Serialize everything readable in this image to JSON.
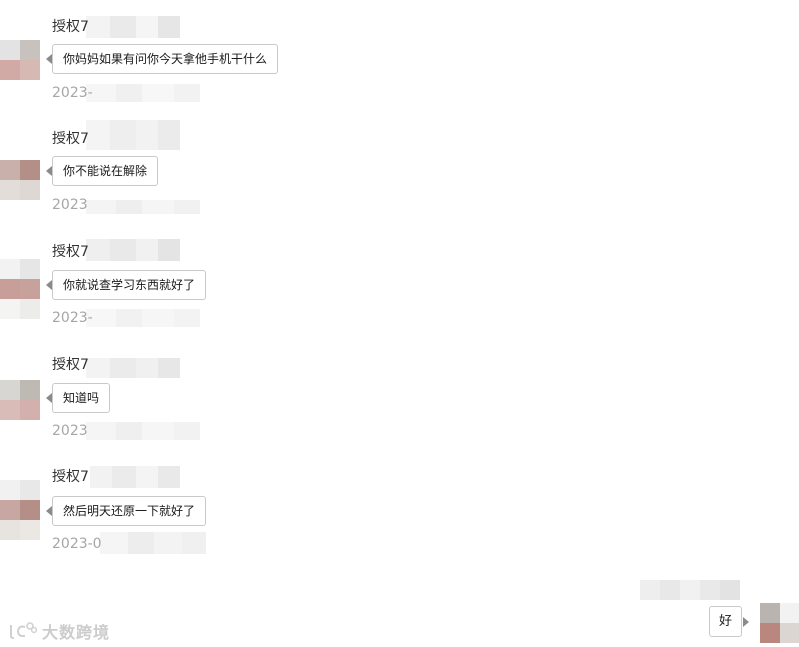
{
  "conversation": {
    "messages": [
      {
        "sender": "授权7",
        "text": "你妈妈如果有问你今天拿他手机干什么",
        "timestamp": "2023-"
      },
      {
        "sender": "授权7",
        "text": "你不能说在解除",
        "timestamp": "2023"
      },
      {
        "sender": "授权7",
        "text": "你就说查学习东西就好了",
        "timestamp": "2023-"
      },
      {
        "sender": "授权7",
        "text": "知道吗",
        "timestamp": "2023"
      },
      {
        "sender": "授权7",
        "text": "然后明天还原一下就好了",
        "timestamp": "2023-0"
      }
    ],
    "sent": {
      "text": "好"
    }
  },
  "watermark": {
    "text": "大数跨境",
    "logo": "lc-logo-icon"
  },
  "colors": {
    "bubble_border": "#c9c9c9",
    "bubble_tail": "#8a8a8a",
    "sender_text": "#333333",
    "timestamp_text": "#a6a6a6"
  }
}
